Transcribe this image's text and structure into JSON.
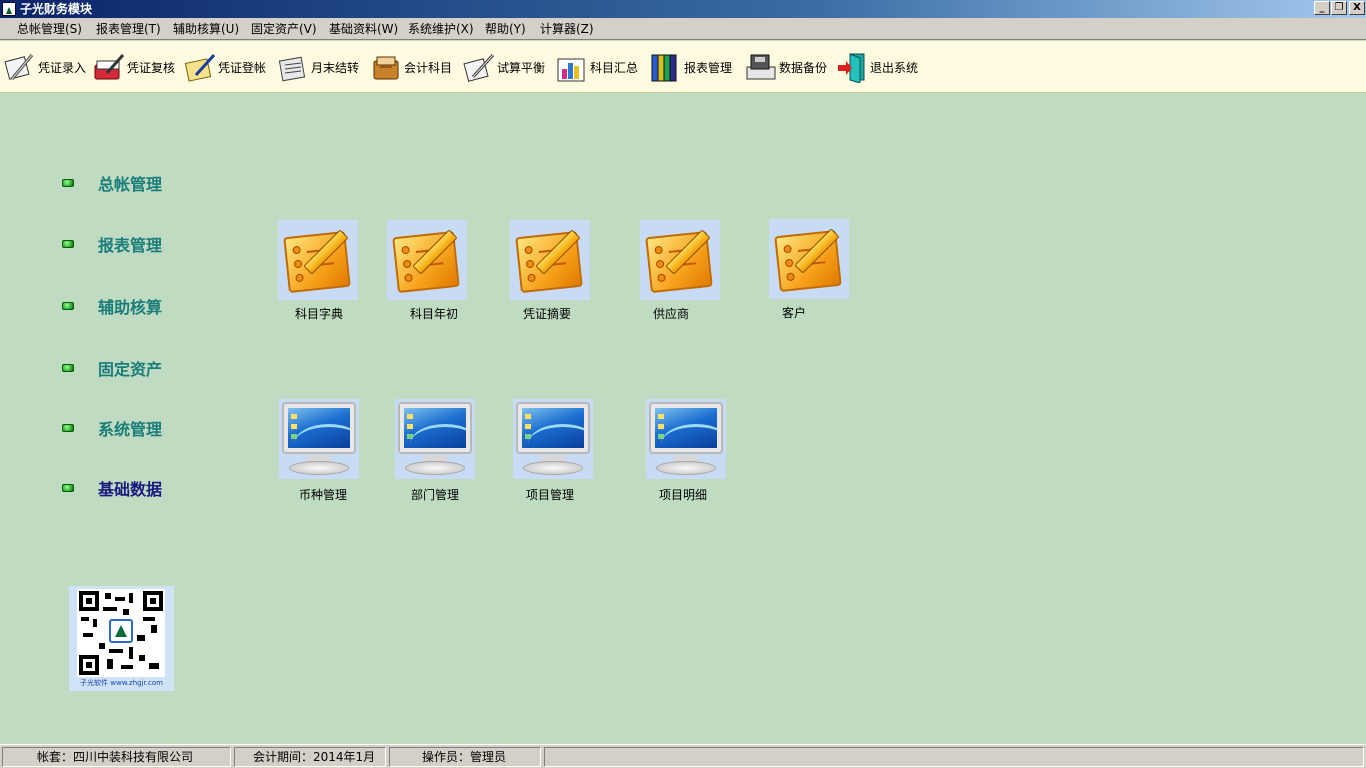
{
  "window": {
    "title": "子光财务模块",
    "minimize": "_",
    "restore": "❐",
    "close": "X"
  },
  "menu": [
    {
      "label": "总帐管理(S)"
    },
    {
      "label": "报表管理(T)"
    },
    {
      "label": "辅助核算(U)"
    },
    {
      "label": "固定资产(V)"
    },
    {
      "label": "基础资料(W)"
    },
    {
      "label": "系统维护(X)"
    },
    {
      "label": "帮助(Y)"
    },
    {
      "label": "计算器(Z)"
    }
  ],
  "toolbar": [
    {
      "label": "凭证录入",
      "icon": "voucher-entry-icon"
    },
    {
      "label": "凭证复核",
      "icon": "voucher-review-icon"
    },
    {
      "label": "凭证登帐",
      "icon": "voucher-post-icon"
    },
    {
      "label": "月末结转",
      "icon": "month-end-icon"
    },
    {
      "label": "会计科目",
      "icon": "accounts-icon"
    },
    {
      "label": "试算平衡",
      "icon": "trial-balance-icon"
    },
    {
      "label": "科目汇总",
      "icon": "account-summary-icon"
    },
    {
      "label": "报表管理",
      "icon": "reports-icon"
    },
    {
      "label": "数据备份",
      "icon": "backup-icon"
    },
    {
      "label": "退出系统",
      "icon": "exit-icon"
    }
  ],
  "nav": [
    {
      "label": "总帐管理"
    },
    {
      "label": "报表管理"
    },
    {
      "label": "辅助核算"
    },
    {
      "label": "固定资产"
    },
    {
      "label": "系统管理"
    },
    {
      "label": "基础数据",
      "active": true
    }
  ],
  "tiles_row1": [
    {
      "label": "科目字典"
    },
    {
      "label": "科目年初"
    },
    {
      "label": "凭证摘要"
    },
    {
      "label": "供应商"
    },
    {
      "label": "客户"
    }
  ],
  "tiles_row2": [
    {
      "label": "币种管理"
    },
    {
      "label": "部门管理"
    },
    {
      "label": "项目管理"
    },
    {
      "label": "项目明细"
    }
  ],
  "qr": {
    "caption": "子光软件 www.zhgjr.com"
  },
  "status": {
    "account": "帐套：四川中装科技有限公司",
    "period": "会计期间：2014年1月",
    "operator": "操作员：管理员"
  },
  "colors": {
    "background": "#bfdcc2",
    "toolbar_bg": "#fffbe0",
    "nav_text": "#1a7d7a",
    "nav_active": "#1a1a7d"
  }
}
